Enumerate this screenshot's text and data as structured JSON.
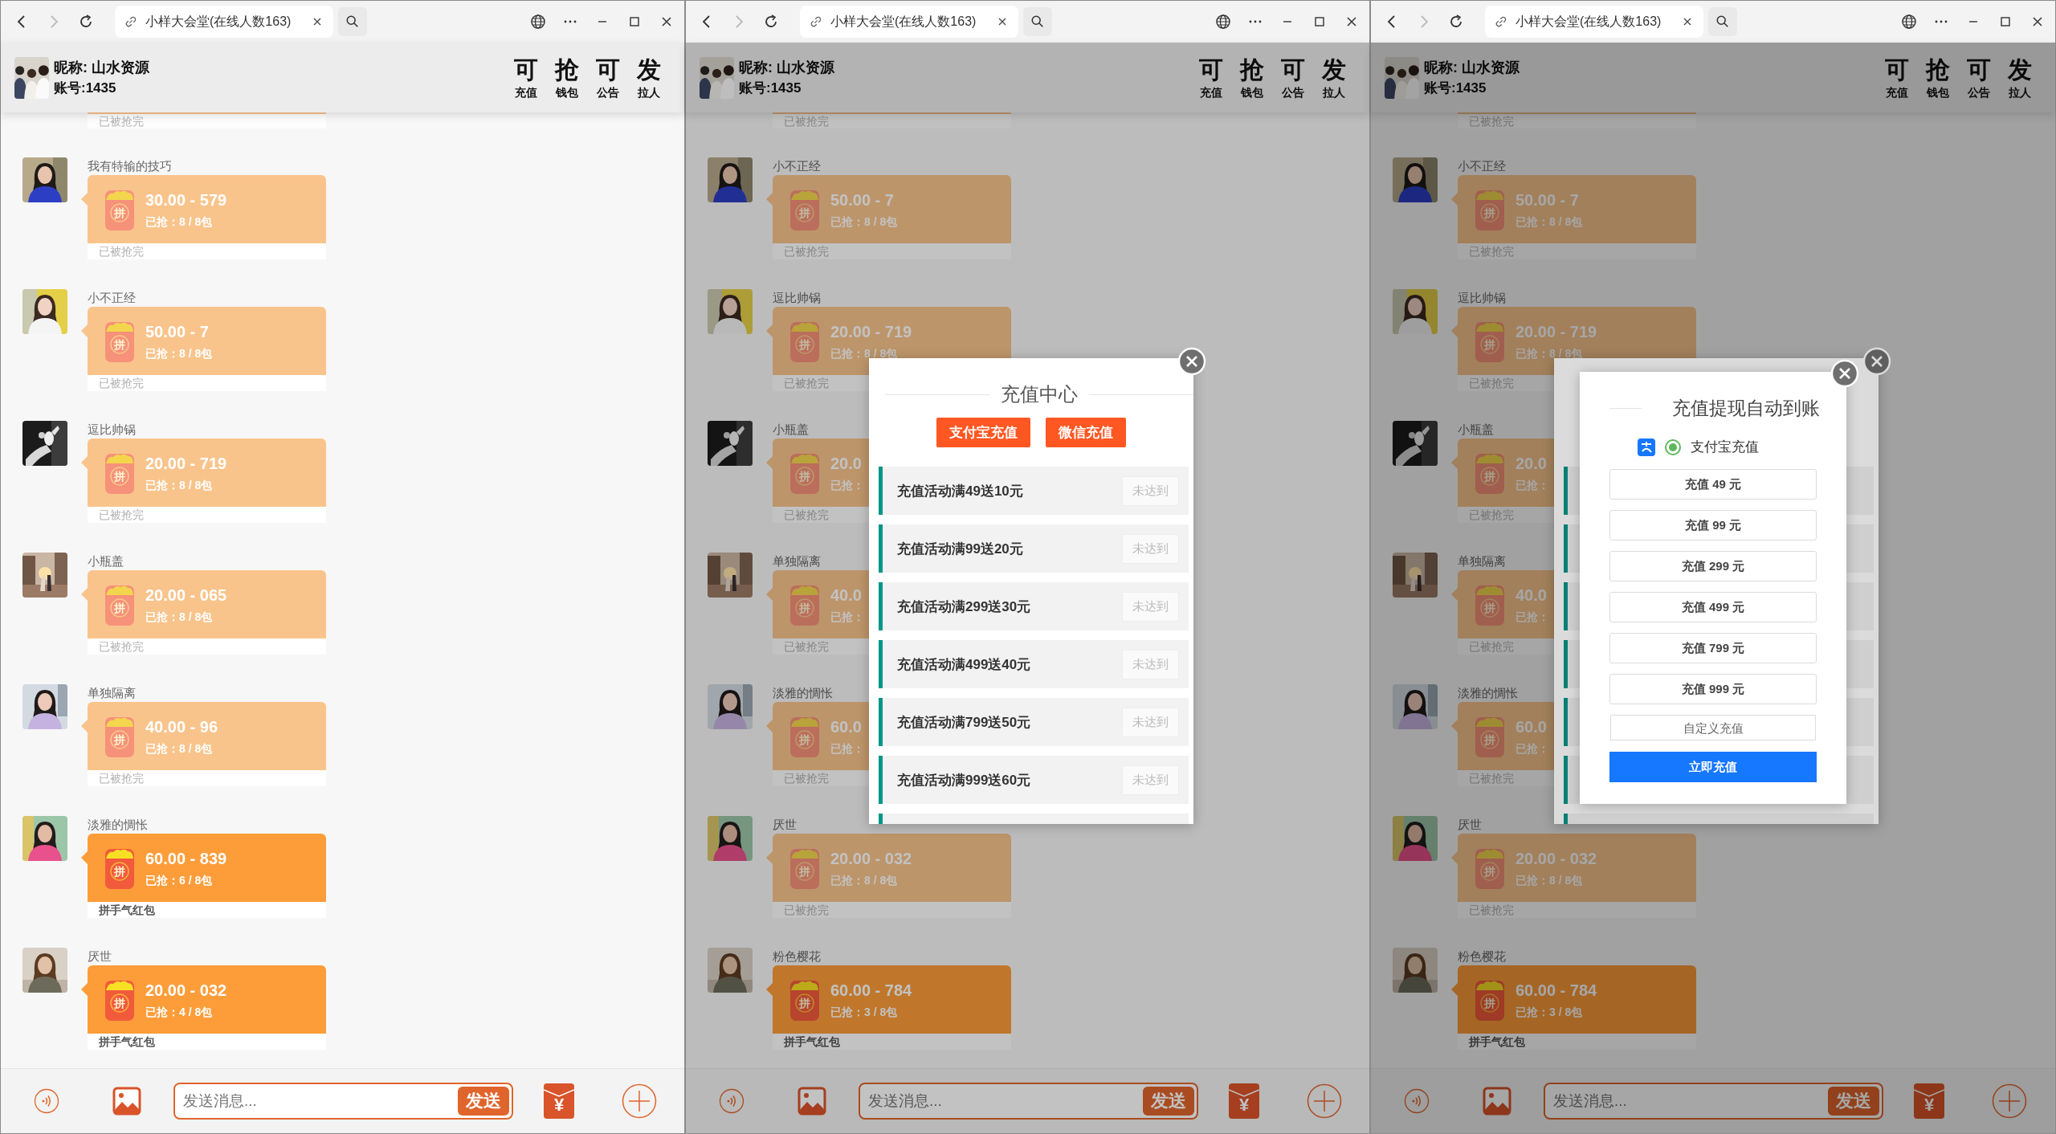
{
  "windows": [
    {
      "tab": {
        "title": "小样大会堂(在线人数163)"
      },
      "nav": {
        "forward_disabled": true
      },
      "header": {
        "nickname": "昵称: 山水资源",
        "account": "账号:1435",
        "actions": [
          {
            "glyph": "可",
            "label": "充值"
          },
          {
            "glyph": "抢",
            "label": "钱包"
          },
          {
            "glyph": "可",
            "label": "公告"
          },
          {
            "glyph": "发",
            "label": "拉人"
          }
        ]
      },
      "top_footer": "已被抢完",
      "messages": [
        {
          "name": "我有特输的技巧",
          "finished": true,
          "icon_text": "拼",
          "amount": "30.00 - 579",
          "grabbed": "已抢：8 / 8包",
          "footer": "已被抢完"
        },
        {
          "name": "小不正经",
          "finished": true,
          "icon_text": "拼",
          "amount": "50.00 - 7",
          "grabbed": "已抢：8 / 8包",
          "footer": "已被抢完"
        },
        {
          "name": "逗比帅锅",
          "finished": true,
          "icon_text": "拼",
          "amount": "20.00 - 719",
          "grabbed": "已抢：8 / 8包",
          "footer": "已被抢完"
        },
        {
          "name": "小瓶盖",
          "finished": true,
          "icon_text": "拼",
          "amount": "20.00 - 065",
          "grabbed": "已抢：8 / 8包",
          "footer": "已被抢完"
        },
        {
          "name": "单独隔离",
          "finished": true,
          "icon_text": "拼",
          "amount": "40.00 - 96",
          "grabbed": "已抢：8 / 8包",
          "footer": "已被抢完"
        },
        {
          "name": "淡雅的惆怅",
          "finished": false,
          "icon_text": "拼",
          "amount": "60.00 - 839",
          "grabbed": "已抢：6 / 8包",
          "footer": "拼手气红包"
        },
        {
          "name": "厌世",
          "finished": false,
          "icon_text": "拼",
          "amount": "20.00 - 032",
          "grabbed": "已抢：4 / 8包",
          "footer": "拼手气红包"
        }
      ],
      "composer": {
        "placeholder": "发送消息...",
        "send": "发送",
        "packet_symbol": "¥"
      }
    },
    {
      "tab": {
        "title": "小样大会堂(在线人数163)"
      },
      "nav": {
        "forward_disabled": true
      },
      "header": {
        "nickname": "昵称: 山水资源",
        "account": "账号:1435",
        "actions": [
          {
            "glyph": "可",
            "label": "充值"
          },
          {
            "glyph": "抢",
            "label": "钱包"
          },
          {
            "glyph": "可",
            "label": "公告"
          },
          {
            "glyph": "发",
            "label": "拉人"
          }
        ]
      },
      "top_footer": "已被抢完",
      "messages": [
        {
          "name": "小不正经",
          "finished": true,
          "icon_text": "拼",
          "amount": "50.00 - 7",
          "grabbed": "已抢：8 / 8包",
          "footer": "已被抢完"
        },
        {
          "name": "逗比帅锅",
          "finished": true,
          "icon_text": "拼",
          "amount": "20.00 - 719",
          "grabbed": "已抢：8 / 8包",
          "footer": "已被抢完"
        },
        {
          "name": "小瓶盖",
          "finished": true,
          "icon_text": "拼",
          "amount": "20.0",
          "grabbed": "已抢：",
          "footer": "已被抢完"
        },
        {
          "name": "单独隔离",
          "finished": true,
          "icon_text": "拼",
          "amount": "40.0",
          "grabbed": "已抢：",
          "footer": "已被抢完"
        },
        {
          "name": "淡雅的惆怅",
          "finished": true,
          "icon_text": "拼",
          "amount": "60.0",
          "grabbed": "已抢：",
          "footer": "已被抢完"
        },
        {
          "name": "厌世",
          "finished": true,
          "icon_text": "拼",
          "amount": "20.00 - 032",
          "grabbed": "已抢：8 / 8包",
          "footer": "已被抢完"
        },
        {
          "name": "粉色樱花",
          "finished": false,
          "icon_text": "拼",
          "amount": "60.00 - 784",
          "grabbed": "已抢：3 / 8包",
          "footer": "拼手气红包"
        }
      ],
      "composer": {
        "placeholder": "发送消息...",
        "send": "发送",
        "packet_symbol": "¥"
      },
      "dialogs": [
        {
          "kind": "activity",
          "title": "充值中心",
          "buttons": [
            "支付宝充值",
            "微信充值"
          ],
          "rows": [
            {
              "kind": "full",
              "label": "充值活动满49送10元",
              "status": "未达到"
            },
            {
              "kind": "full",
              "label": "充值活动满99送20元",
              "status": "未达到"
            },
            {
              "kind": "full",
              "label": "充值活动满299送30元",
              "status": "未达到"
            },
            {
              "kind": "full",
              "label": "充值活动满499送40元",
              "status": "未达到"
            },
            {
              "kind": "full",
              "label": "充值活动满799送50元",
              "status": "未达到"
            },
            {
              "kind": "full",
              "label": "充值活动满999送60元",
              "status": "未达到"
            },
            {
              "kind": "bar"
            }
          ]
        }
      ]
    },
    {
      "tab": {
        "title": "小样大会堂(在线人数163)"
      },
      "nav": {
        "forward_disabled": true
      },
      "header": {
        "nickname": "昵称: 山水资源",
        "account": "账号:1435",
        "actions": [
          {
            "glyph": "可",
            "label": "充值"
          },
          {
            "glyph": "抢",
            "label": "钱包"
          },
          {
            "glyph": "可",
            "label": "公告"
          },
          {
            "glyph": "发",
            "label": "拉人"
          }
        ]
      },
      "top_footer": "已被抢完",
      "messages": [
        {
          "name": "小不正经",
          "finished": true,
          "icon_text": "拼",
          "amount": "50.00 - 7",
          "grabbed": "已抢：8 / 8包",
          "footer": "已被抢完"
        },
        {
          "name": "逗比帅锅",
          "finished": true,
          "icon_text": "拼",
          "amount": "20.00 - 719",
          "grabbed": "已抢：8 / 8包",
          "footer": "已被抢完"
        },
        {
          "name": "小瓶盖",
          "finished": true,
          "icon_text": "拼",
          "amount": "20.0",
          "grabbed": "已抢：",
          "footer": "已被抢完"
        },
        {
          "name": "单独隔离",
          "finished": true,
          "icon_text": "拼",
          "amount": "40.0",
          "grabbed": "已抢：",
          "footer": "已被抢完"
        },
        {
          "name": "淡雅的惆怅",
          "finished": true,
          "icon_text": "拼",
          "amount": "60.0",
          "grabbed": "已抢：",
          "footer": "已被抢完"
        },
        {
          "name": "厌世",
          "finished": true,
          "icon_text": "拼",
          "amount": "20.00 - 032",
          "grabbed": "已抢：8 / 8包",
          "footer": "已被抢完"
        },
        {
          "name": "粉色樱花",
          "finished": false,
          "icon_text": "拼",
          "amount": "60.00 - 784",
          "grabbed": "已抢：3 / 8包",
          "footer": "拼手气红包"
        }
      ],
      "composer": {
        "placeholder": "发送消息...",
        "send": "发送",
        "packet_symbol": "¥"
      },
      "dialogs": [
        {
          "kind": "activity",
          "rows": [
            {
              "kind": "bar"
            },
            {
              "kind": "bar"
            },
            {
              "kind": "bar"
            },
            {
              "kind": "bar"
            },
            {
              "kind": "bar"
            },
            {
              "kind": "bar"
            },
            {
              "kind": "bar"
            }
          ]
        },
        {
          "kind": "recharge",
          "title": "充值提现自动到账",
          "method": {
            "label": "支付宝充值",
            "selected": true
          },
          "amounts": [
            "充值 49 元",
            "充值 99 元",
            "充值 299 元",
            "充值 499 元",
            "充值 799 元",
            "充值 999 元"
          ],
          "custom": {
            "placeholder": "自定义充值"
          },
          "submit": "立即充值"
        }
      ]
    }
  ]
}
